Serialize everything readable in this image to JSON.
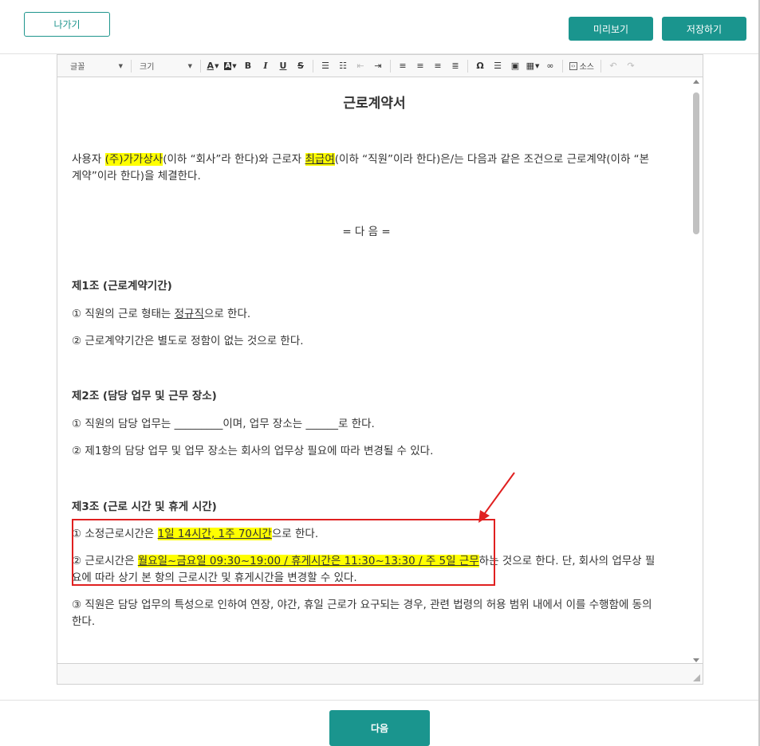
{
  "header": {
    "back_label": "나가기",
    "preview_label": "미리보기",
    "save_label": "저장하기"
  },
  "toolbar": {
    "font_label": "글꼴",
    "size_label": "크기",
    "bold": "B",
    "italic": "I",
    "underline": "U",
    "strike": "S",
    "omega": "Ω",
    "source_label": "소스"
  },
  "document": {
    "title": "근로계약서",
    "intro_1": "사용자 ",
    "employer": "(주)가가상사",
    "intro_2": "(이하 “회사”라 한다)와 근로자 ",
    "employee": "최급여",
    "intro_3": "(이하 “직원”이라 한다)은/는 다음과 같은 조건으로 근로계약(이하 “본 계약”이라 한다)을 체결한다.",
    "center_heading": "= 다 음 =",
    "art1_title": "제1조 (근로계약기간)",
    "art1_p1_a": "① 직원의 근로 형태는 ",
    "art1_p1_u": "정규직",
    "art1_p1_b": "으로 한다.",
    "art1_p2": "② 근로계약기간은 별도로 정함이 없는 것으로 한다.",
    "art2_title": "제2조 (담당 업무 및 근무 장소)",
    "art2_p1": "① 직원의 담당 업무는 _________이며, 업무 장소는 ______로 한다.",
    "art2_p2": "② 제1항의 담당 업무 및 업무 장소는 회사의 업무상 필요에 따라 변경될 수 있다.",
    "art3_title": "제3조 (근로 시간 및 휴게 시간)",
    "art3_p1_a": "① 소정근로시간은 ",
    "art3_p1_hl": "1일 14시간, 1주 70시간",
    "art3_p1_b": "으로 한다.",
    "art3_p2_a": "② 근로시간은 ",
    "art3_p2_hl": "월요일~금요일 09:30~19:00 / 휴게시간은 11:30~13:30 / 주 5일 근무",
    "art3_p2_b": "하는 것으로 한다. 단, 회사의 업무상 필요에 따라 상기 본 항의 근로시간 및 휴게시간을 변경할 수 있다.",
    "art3_p3": "③ 직원은 담당 업무의 특성으로 인하여 연장, 야간, 휴일 근로가 요구되는 경우, 관련 법령의 허용 범위 내에서 이를 수행함에 동의한다."
  },
  "footer": {
    "next_label": "다음"
  },
  "colors": {
    "accent": "#1a958e",
    "highlight": "#ffff00",
    "annotation": "#e02020"
  }
}
